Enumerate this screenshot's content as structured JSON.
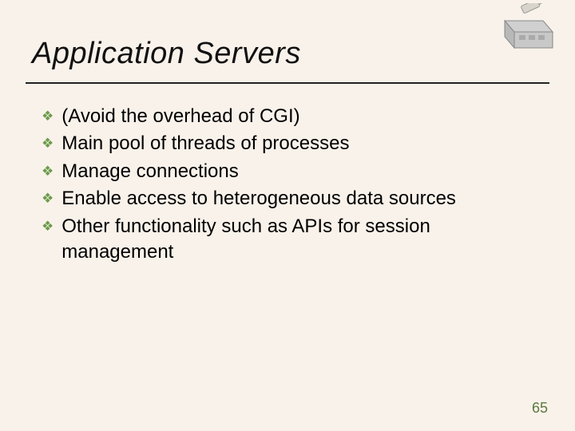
{
  "title": "Application Servers",
  "bullets": {
    "b0": "(Avoid the overhead of CGI)",
    "b1": "Main pool of threads of processes",
    "b2": "Manage connections",
    "b3": "Enable access to heterogeneous data sources",
    "b4": "Other functionality such as APIs for session management"
  },
  "page_number": "65"
}
